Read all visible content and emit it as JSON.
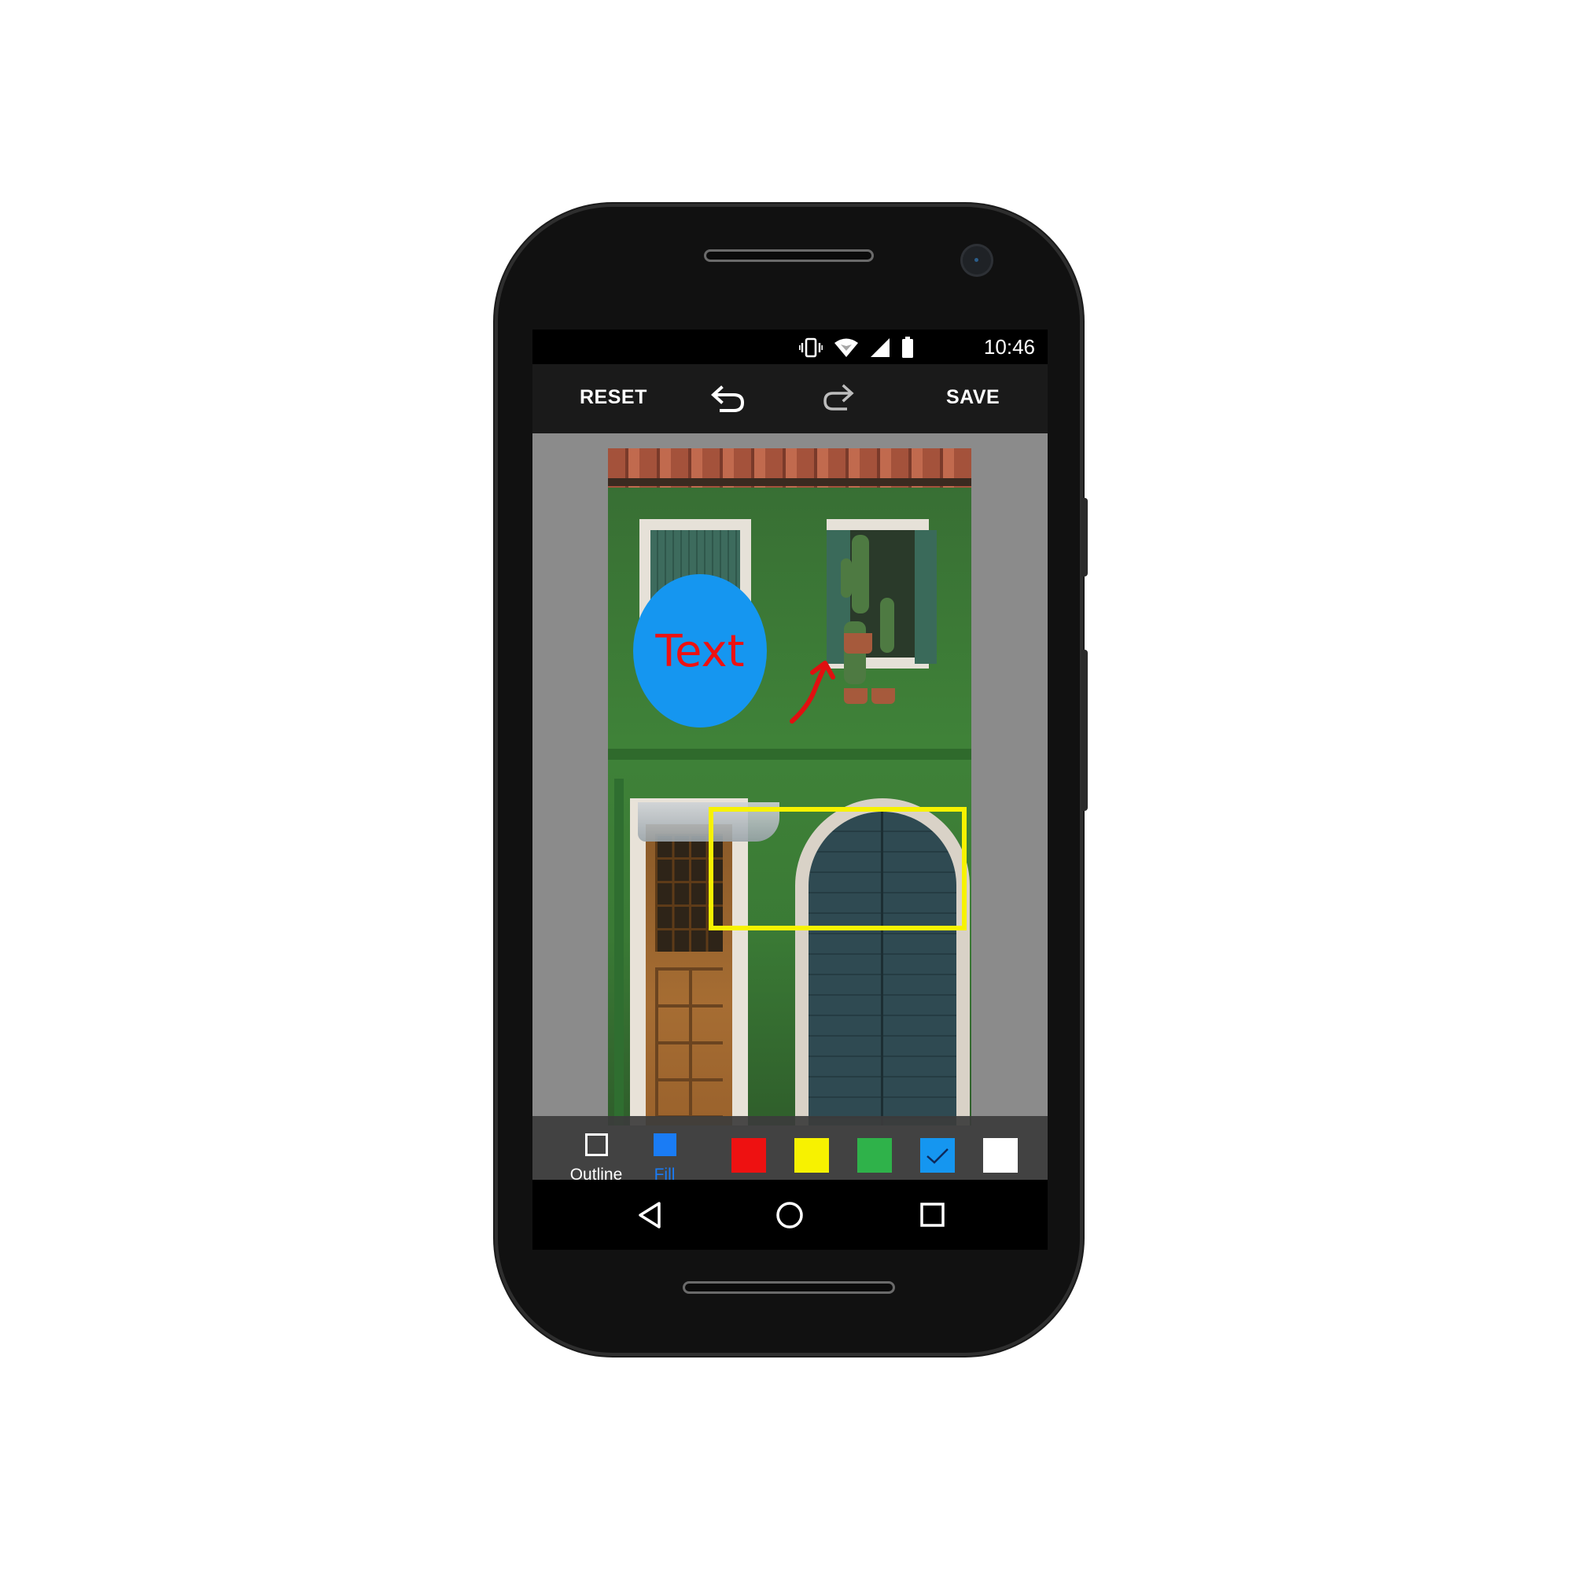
{
  "status_bar": {
    "time": "10:46",
    "icons": [
      "vibrate-icon",
      "wifi-icon",
      "signal-icon",
      "battery-icon"
    ]
  },
  "toolbar": {
    "reset_label": "RESET",
    "save_label": "SAVE",
    "undo_icon": "undo-icon",
    "redo_icon": "redo-icon"
  },
  "canvas": {
    "text_annotation": "Text",
    "ellipse_color": "#1596f0",
    "text_color": "#ee1111",
    "rect_color": "#f7f200",
    "arrow_color": "#e01010"
  },
  "shape_options": {
    "outline_label": "Outline",
    "fill_label": "Fill",
    "selected_mode": "Fill",
    "accent": "#1a7cf5"
  },
  "palette": {
    "colors": [
      "#ee1111",
      "#f7f200",
      "#2fb24a",
      "#1596f0",
      "#ffffff"
    ],
    "selected": "#1596f0"
  },
  "tools": {
    "items": [
      "text-tool-icon",
      "pencil-tool-icon",
      "shape-tool-icon",
      "crop-tool-icon"
    ],
    "selected": "shape-tool-icon"
  },
  "nav_bar": {
    "items": [
      "back-icon",
      "home-icon",
      "recents-icon"
    ]
  }
}
